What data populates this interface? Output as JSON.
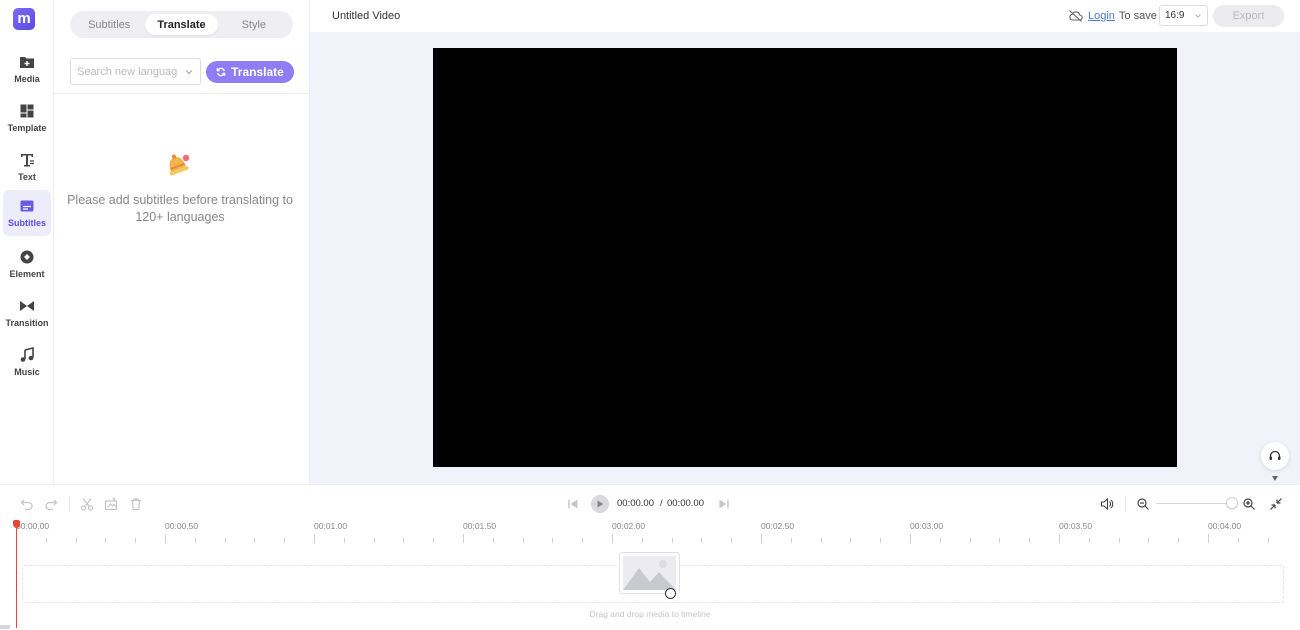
{
  "nav": {
    "logo": "m",
    "items": [
      {
        "label": "Media",
        "icon": "folder-plus-icon"
      },
      {
        "label": "Template",
        "icon": "grid-icon"
      },
      {
        "label": "Text",
        "icon": "text-tool-icon"
      },
      {
        "label": "Subtitles",
        "icon": "subtitles-icon"
      },
      {
        "label": "Element",
        "icon": "shapes-icon"
      },
      {
        "label": "Transition",
        "icon": "transition-icon"
      },
      {
        "label": "Music",
        "icon": "music-note-icon"
      }
    ],
    "active": "Subtitles"
  },
  "panel": {
    "tabs": [
      "Subtitles",
      "Translate",
      "Style"
    ],
    "active_tab": "Translate",
    "language_search": {
      "placeholder": "Search new language",
      "value": ""
    },
    "translate_button": "Translate",
    "empty_message": "Please add subtitles before translating to 120+ languages",
    "empty_icon": "bell-icon"
  },
  "header": {
    "title": "Untitled Video",
    "save_status_icon": "cloud-off-icon",
    "login_link": "Login",
    "save_text": "To save",
    "aspect_ratio": "16:9",
    "export_button": "Export"
  },
  "colors": {
    "accent": "#8e7df4",
    "brand": "#6a5ae8",
    "canvas": "#000000",
    "stage_bg": "#f2f2fb",
    "playhead": "#e7453b"
  },
  "timeline": {
    "current_time": "00:00.00",
    "separator": "/",
    "total_time": "00:00.00",
    "ruler_labels": [
      "00:00.00",
      "00:00.50",
      "00:01.00",
      "00:01.50",
      "00:02.00",
      "00:02.50",
      "00:03.00",
      "00:03.50",
      "00:04.00"
    ],
    "drop_hint": "Drag and drop media to timeline",
    "toolbar_icons": [
      "undo-icon",
      "redo-icon",
      "split-icon",
      "crop-icon",
      "delete-icon"
    ],
    "transport_icons": [
      "skip-back-icon",
      "play-icon",
      "skip-forward-icon"
    ],
    "right_icons": [
      "volume-icon",
      "zoom-out-icon",
      "zoom-in-icon",
      "collapse-icon"
    ]
  }
}
